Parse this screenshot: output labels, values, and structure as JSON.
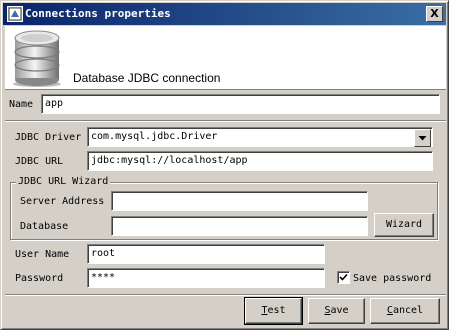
{
  "window": {
    "title": "Connections properties",
    "close_glyph": "X"
  },
  "header": {
    "title": "Database JDBC connection",
    "icon": "database-icon"
  },
  "name": {
    "label": "Name",
    "value": "app"
  },
  "jdbc_driver": {
    "label": "JDBC Driver",
    "value": "com.mysql.jdbc.Driver"
  },
  "jdbc_url": {
    "label": "JDBC URL",
    "value": "jdbc:mysql://localhost/app"
  },
  "wizard": {
    "group_title": "JDBC URL Wizard",
    "server_address_label": "Server Address",
    "server_address_value": "",
    "database_label": "Database",
    "database_value": "",
    "button_label": "Wizard"
  },
  "user_name": {
    "label": "User Name",
    "value": "root"
  },
  "password": {
    "label": "Password",
    "value": "****",
    "save_label": "Save password",
    "save_checked": true
  },
  "buttons": {
    "test": {
      "mnemonic": "T",
      "rest": "est"
    },
    "save": {
      "mnemonic": "S",
      "rest": "ave"
    },
    "cancel": {
      "mnemonic": "C",
      "rest": "ancel"
    }
  }
}
